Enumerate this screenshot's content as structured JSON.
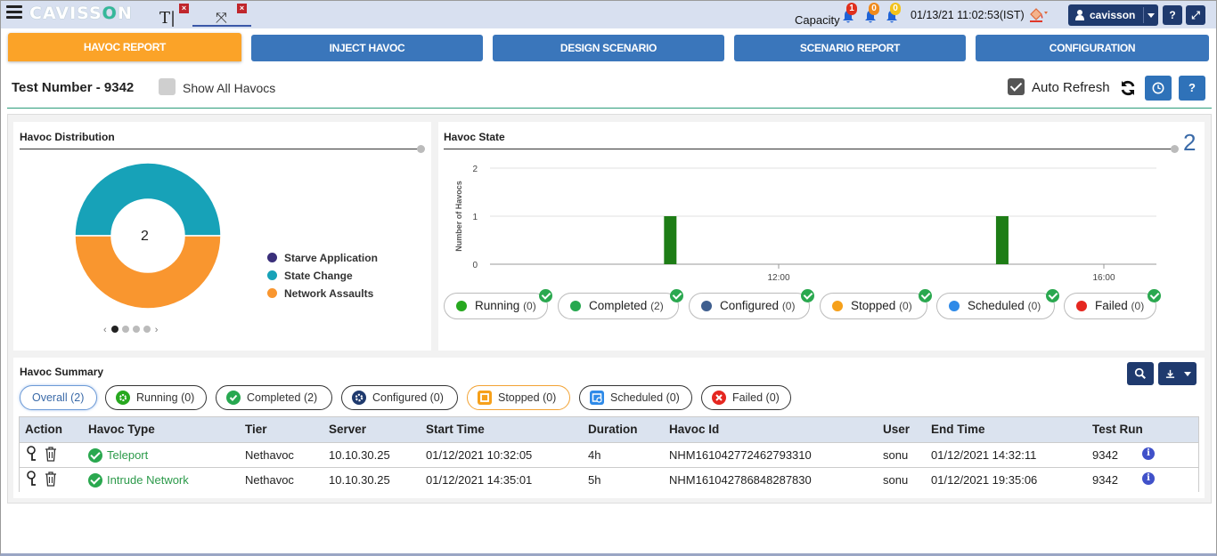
{
  "app": {
    "logo_text_start": "CAVISS",
    "logo_text_o": "O",
    "logo_text_end": "N",
    "tab1_glyph": "T|",
    "tab2_glyph": "⤧",
    "capacity_label": "Capacity",
    "alerts": [
      {
        "count": "1",
        "color": "#e0301e"
      },
      {
        "count": "0",
        "color": "#f08a1c"
      },
      {
        "count": "0",
        "color": "#f2c21a"
      }
    ],
    "datetime": "01/13/21 11:02:53(IST)",
    "user": "cavisson",
    "help_label": "?",
    "expand_label": "⤢"
  },
  "nav": {
    "tabs": [
      {
        "label": "HAVOC REPORT",
        "active": true
      },
      {
        "label": "INJECT HAVOC",
        "active": false
      },
      {
        "label": "DESIGN SCENARIO",
        "active": false
      },
      {
        "label": "SCENARIO REPORT",
        "active": false
      },
      {
        "label": "CONFIGURATION",
        "active": false
      }
    ]
  },
  "header": {
    "test_number": "Test Number - 9342",
    "show_all_label": "Show All Havocs",
    "auto_refresh_label": "Auto Refresh",
    "help_label": "?"
  },
  "distribution": {
    "title": "Havoc Distribution",
    "center_value": "2",
    "legend": [
      {
        "label": "Starve Application",
        "color": "#3a2f7a"
      },
      {
        "label": "State Change",
        "color": "#17a2b8"
      },
      {
        "label": "Network Assaults",
        "color": "#f9962f"
      }
    ],
    "pager_prev": "‹",
    "pager_next": "›"
  },
  "chart_data": {
    "type": "donut",
    "categories": [
      "Starve Application",
      "State Change",
      "Network Assaults"
    ],
    "values": [
      0,
      1,
      1
    ],
    "colors": [
      "#3a2f7a",
      "#17a2b8",
      "#f9962f"
    ]
  },
  "state": {
    "title": "Havoc State",
    "total": "2",
    "ylabel": "Number of Havocs",
    "yticks": [
      "0",
      "1",
      "2"
    ],
    "xticks": [
      "12:00",
      "16:00"
    ],
    "bars": [
      {
        "x": "10:40",
        "value": 1
      },
      {
        "x": "14:45",
        "value": 1
      }
    ],
    "bar_color": "#1e7d16",
    "pills": [
      {
        "label": "Running",
        "count": "(0)",
        "color": "#27a81f"
      },
      {
        "label": "Completed",
        "count": "(2)",
        "color": "#27a850"
      },
      {
        "label": "Configured",
        "count": "(0)",
        "color": "#3f5f8f"
      },
      {
        "label": "Stopped",
        "count": "(0)",
        "color": "#f6a01a"
      },
      {
        "label": "Scheduled",
        "count": "(0)",
        "color": "#2e8ae8"
      },
      {
        "label": "Failed",
        "count": "(0)",
        "color": "#e52720"
      }
    ]
  },
  "summary": {
    "title": "Havoc Summary",
    "filters": [
      {
        "label": "Overall",
        "count": "(2)"
      },
      {
        "label": "Running",
        "count": "(0)",
        "color": "#27a81f"
      },
      {
        "label": "Completed",
        "count": "(2)",
        "color": "#27a850"
      },
      {
        "label": "Configured",
        "count": "(0)",
        "color": "#1f3a6e"
      },
      {
        "label": "Stopped",
        "count": "(0)",
        "color": "#f6a01a"
      },
      {
        "label": "Scheduled",
        "count": "(0)",
        "color": "#2e8ae8"
      },
      {
        "label": "Failed",
        "count": "(0)",
        "color": "#e52720"
      }
    ],
    "columns": [
      "Action",
      "Havoc Type",
      "Tier",
      "Server",
      "Start Time",
      "Duration",
      "Havoc Id",
      "User",
      "End Time",
      "Test Run"
    ],
    "rows": [
      {
        "type": "Teleport",
        "tier": "Nethavoc",
        "server": "10.10.30.25",
        "start": "01/12/2021 10:32:05",
        "duration": "4h",
        "id": "NHM161042772462793310",
        "user": "sonu",
        "end": "01/12/2021 14:32:11",
        "run": "9342"
      },
      {
        "type": "Intrude Network",
        "tier": "Nethavoc",
        "server": "10.10.30.25",
        "start": "01/12/2021 14:35:01",
        "duration": "5h",
        "id": "NHM161042786848287830",
        "user": "sonu",
        "end": "01/12/2021 19:35:06",
        "run": "9342"
      }
    ],
    "info_glyph": "i"
  }
}
